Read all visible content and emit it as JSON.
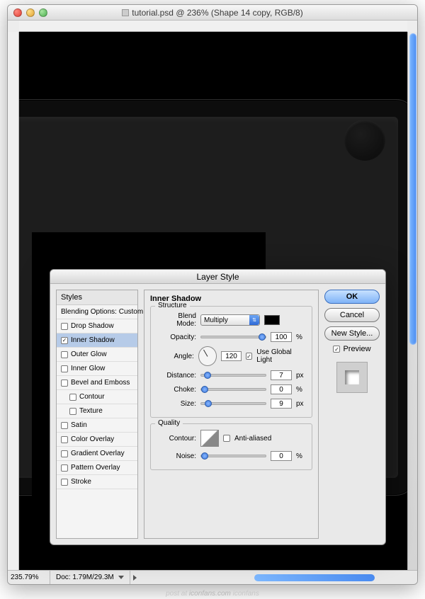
{
  "window": {
    "title": "tutorial.psd @ 236% (Shape 14 copy, RGB/8)"
  },
  "status": {
    "zoom": "235.79%",
    "docsize": "Doc: 1.79M/29.3M"
  },
  "dialog": {
    "title": "Layer Style",
    "styles_header": "Styles",
    "blending_opts": "Blending Options: Custom",
    "items": [
      {
        "label": "Drop Shadow",
        "checked": false
      },
      {
        "label": "Inner Shadow",
        "checked": true,
        "selected": true
      },
      {
        "label": "Outer Glow",
        "checked": false
      },
      {
        "label": "Inner Glow",
        "checked": false
      },
      {
        "label": "Bevel and Emboss",
        "checked": false
      },
      {
        "label": "Contour",
        "checked": false,
        "indent": true
      },
      {
        "label": "Texture",
        "checked": false,
        "indent": true
      },
      {
        "label": "Satin",
        "checked": false
      },
      {
        "label": "Color Overlay",
        "checked": false
      },
      {
        "label": "Gradient Overlay",
        "checked": false
      },
      {
        "label": "Pattern Overlay",
        "checked": false
      },
      {
        "label": "Stroke",
        "checked": false
      }
    ],
    "panel_title": "Inner Shadow",
    "structure": {
      "legend": "Structure",
      "blend_mode_label": "Blend Mode:",
      "blend_mode": "Multiply",
      "opacity_label": "Opacity:",
      "opacity": "100",
      "opacity_unit": "%",
      "angle_label": "Angle:",
      "angle": "120",
      "global_light": "Use Global Light",
      "distance_label": "Distance:",
      "distance": "7",
      "distance_unit": "px",
      "choke_label": "Choke:",
      "choke": "0",
      "choke_unit": "%",
      "size_label": "Size:",
      "size": "9",
      "size_unit": "px"
    },
    "quality": {
      "legend": "Quality",
      "contour_label": "Contour:",
      "anti_aliased": "Anti-aliased",
      "noise_label": "Noise:",
      "noise": "0",
      "noise_unit": "%"
    },
    "buttons": {
      "ok": "OK",
      "cancel": "Cancel",
      "new_style": "New Style...",
      "preview": "Preview"
    }
  },
  "watermark": {
    "prefix": "post at ",
    "domain": "iconfans.com ",
    "brand": "iconfans"
  }
}
